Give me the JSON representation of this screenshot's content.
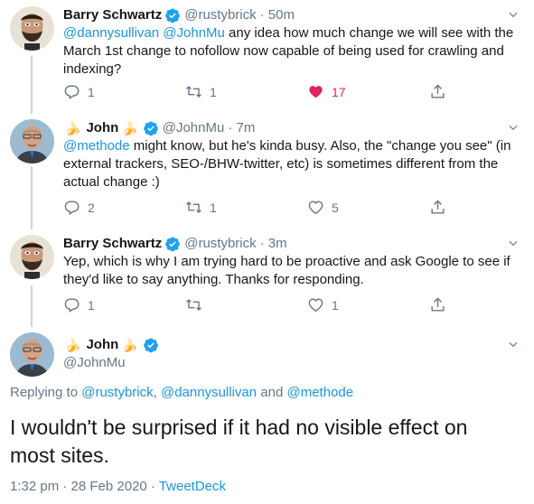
{
  "tweets": [
    {
      "name": "Barry Schwartz",
      "handle": "@rustybrick",
      "time": "· 50m",
      "text_mentions": "@dannysullivan @JohnMu",
      "text": " any idea how much change we will see with the March 1st change to nofollow now capable of being used for crawling and indexing?",
      "replies": "1",
      "retweets": "1",
      "likes": "17",
      "liked": true
    },
    {
      "name": "John",
      "emoji_left": "🍌",
      "emoji_right": "🍌",
      "handle": "@JohnMu",
      "time": "· 7m",
      "text_mentions": "@methode",
      "text": " might know, but he's kinda busy. Also, the \"change you see\" (in external trackers, SEO-/BHW-twitter, etc) is sometimes different from the actual change :)",
      "replies": "2",
      "retweets": "1",
      "likes": "5",
      "liked": false
    },
    {
      "name": "Barry Schwartz",
      "handle": "@rustybrick",
      "time": "· 3m",
      "text": "Yep, which is why I am trying hard to be proactive and ask Google to see if they'd like to say anything.  Thanks for responding.",
      "replies": "1",
      "retweets": "",
      "likes": "1",
      "liked": false
    }
  ],
  "main_tweet": {
    "name": "John",
    "emoji_left": "🍌",
    "emoji_right": "🍌",
    "handle": "@JohnMu",
    "replying_prefix": "Replying to ",
    "replying_user1": "@rustybrick",
    "replying_sep": ", ",
    "replying_user2": "@dannysullivan",
    "replying_and": " and ",
    "replying_user3": "@methode",
    "text": "I wouldn't be surprised if it had no visible effect on most sites.",
    "time": "1:32 pm · 28 Feb 2020 · ",
    "source": "TweetDeck"
  },
  "colors": {
    "link": "#1b95e0",
    "muted": "#657786",
    "like": "#e0245e",
    "verified": "#1da1f2"
  },
  "icons": [
    "reply-icon",
    "retweet-icon",
    "like-icon",
    "share-icon",
    "verified-icon",
    "chevron-down-icon"
  ]
}
